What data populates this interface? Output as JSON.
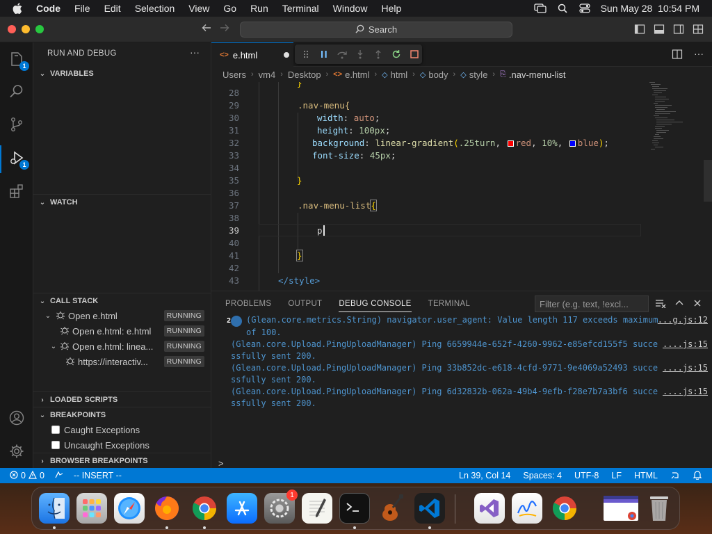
{
  "menubar": {
    "app": "Code",
    "items": [
      "File",
      "Edit",
      "Selection",
      "View",
      "Go",
      "Run",
      "Terminal",
      "Window",
      "Help"
    ],
    "clock": "Sun May 28  10:54 PM"
  },
  "titlebar": {
    "search": "Search"
  },
  "activity": {
    "explorer_badge": "1",
    "debug_badge": "1"
  },
  "sidebar": {
    "title": "RUN AND DEBUG",
    "variables": "VARIABLES",
    "watch": "WATCH",
    "callstack": {
      "title": "CALL STACK",
      "rows": [
        {
          "label": "Open e.html",
          "status": "RUNNING"
        },
        {
          "label": "Open e.html: e.html",
          "status": "RUNNING"
        },
        {
          "label": "Open e.html: linea...",
          "status": "RUNNING"
        },
        {
          "label": "https://interactiv...",
          "status": "RUNNING"
        }
      ]
    },
    "loaded_scripts": "LOADED SCRIPTS",
    "breakpoints": "BREAKPOINTS",
    "bp_caught": "Caught Exceptions",
    "bp_uncaught": "Uncaught Exceptions",
    "browser_breakpoints": "BROWSER BREAKPOINTS"
  },
  "tab": {
    "name": "e.html",
    "ext_icon": "<>"
  },
  "breadcrumb": [
    "Users",
    "vm4",
    "Desktop",
    "e.html",
    "html",
    "body",
    "style",
    ".nav-menu-list"
  ],
  "editor": {
    "line_numbers": [
      "28",
      "29",
      "30",
      "31",
      "32",
      "33",
      "34",
      "35",
      "36",
      "37",
      "38",
      "39",
      "40",
      "41",
      "42",
      "43"
    ],
    "partial_top": "}",
    "lines": {
      "l29": ".nav-menu{",
      "l30_prop": "width",
      "l30_val": "auto",
      "l31_prop": "height",
      "l31_val": "100px",
      "l32_prop": "background",
      "l32_fn": "linear-gradient",
      "l32_arg1": ".25turn",
      "l32_red": "red",
      "l32_pct": "10%",
      "l32_blue": "blue",
      "l33_prop": "font-size",
      "l33_val": "45px",
      "l35": "}",
      "l37": ".nav-menu-list",
      "l37_brace": "{",
      "l39": "p",
      "l41": "}",
      "l43": "</style>"
    }
  },
  "panel": {
    "tabs": [
      "PROBLEMS",
      "OUTPUT",
      "DEBUG CONSOLE",
      "TERMINAL"
    ],
    "filter_placeholder": "Filter (e.g. text, !excl...",
    "messages": [
      {
        "count": "2",
        "text": "(Glean.core.metrics.String) navigator.user_agent: Value length 117 exceeds maximum of 100.",
        "src": "...g.js:12"
      },
      {
        "text": "(Glean.core.Upload.PingUploadManager) Ping 6659944e-652f-4260-9962-e85efcd155f5 successfully sent 200.",
        "src": "....js:15"
      },
      {
        "text": "(Glean.core.Upload.PingUploadManager) Ping 33b852dc-e618-4cfd-9771-9e4069a52493 successfully sent 200.",
        "src": "....js:15"
      },
      {
        "text": "(Glean.core.Upload.PingUploadManager) Ping 6d32832b-062a-49b4-9efb-f28e7b7a3bf6 successfully sent 200.",
        "src": "....js:15"
      }
    ],
    "prompt": ">"
  },
  "statusbar": {
    "problems": "0",
    "warnings": "0",
    "mode": "-- INSERT --",
    "position": "Ln 39, Col 14",
    "spaces": "Spaces: 4",
    "encoding": "UTF-8",
    "eol": "LF",
    "language": "HTML"
  },
  "colors": {
    "accent": "#0078d4",
    "statusbar": "#0078d4",
    "console_text": "#4e94ce"
  }
}
